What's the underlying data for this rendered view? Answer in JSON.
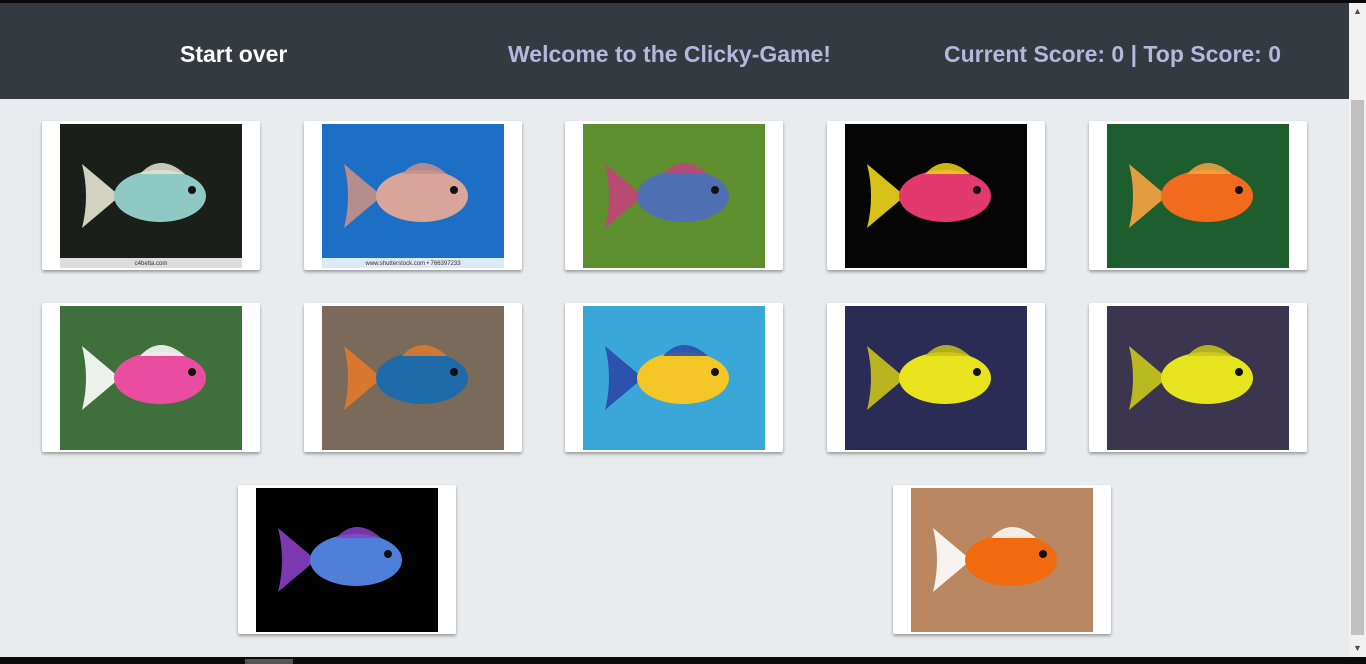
{
  "navbar": {
    "start_over": "Start over",
    "welcome": "Welcome to the Clicky-Game!",
    "score": "Current Score: 0 | Top Score: 0"
  },
  "cards": [
    {
      "name": "betta-white-teal-card",
      "bg": "#1a1f1a",
      "fish": "#8fc9c4",
      "fin": "#e8e4d2",
      "caption": "c4betta.com"
    },
    {
      "name": "flowerhorn-card",
      "bg": "#1d6fc6",
      "fish": "#d9a59a",
      "fin": "#c79086",
      "caption": "www.shutterstock.com • 766397233"
    },
    {
      "name": "blue-betta-card",
      "bg": "#5d8f2e",
      "fish": "#4f6fb3",
      "fin": "#c2437a",
      "caption": ""
    },
    {
      "name": "glofish-card",
      "bg": "#050505",
      "fish": "#e23a6e",
      "fin": "#f0d61b",
      "caption": ""
    },
    {
      "name": "goldfish-card",
      "bg": "#1e5d2e",
      "fish": "#f26b1d",
      "fin": "#f8a341",
      "caption": ""
    },
    {
      "name": "pink-clownfish-card",
      "bg": "#3f6f3a",
      "fish": "#ea4da0",
      "fin": "#ffffff",
      "caption": ""
    },
    {
      "name": "mandarinfish-card",
      "bg": "#7a6a5a",
      "fish": "#1f6aa8",
      "fin": "#e27a2a",
      "caption": ""
    },
    {
      "name": "reef-fish-card",
      "bg": "#3ba6d8",
      "fish": "#f5c726",
      "fin": "#2a4aa8",
      "caption": ""
    },
    {
      "name": "yellow-tang-card",
      "bg": "#2b2c55",
      "fish": "#e9e31e",
      "fin": "#c8c21a",
      "caption": ""
    },
    {
      "name": "yellow-tang-2-card",
      "bg": "#3b3550",
      "fish": "#e5e41f",
      "fin": "#c9c81b",
      "caption": ""
    },
    {
      "name": "halfmoon-betta-card",
      "bg": "#020202",
      "fish": "#4f7fd8",
      "fin": "#8a3fc2",
      "caption": ""
    },
    {
      "name": "clownfish-card",
      "bg": "#b98862",
      "fish": "#f26a0e",
      "fin": "#ffffff",
      "caption": ""
    }
  ]
}
